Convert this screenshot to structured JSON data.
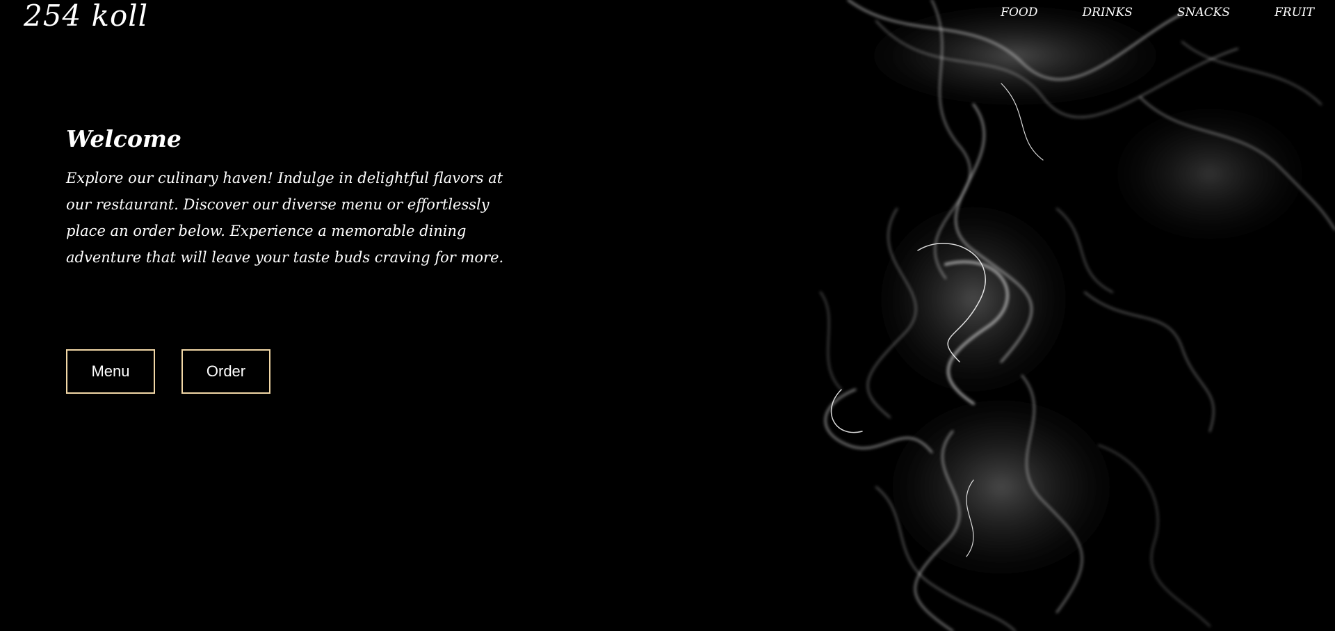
{
  "brand": {
    "logo_text": "254 koll"
  },
  "nav": {
    "items": [
      {
        "label": "FOOD"
      },
      {
        "label": "DRINKS"
      },
      {
        "label": "SNACKS"
      },
      {
        "label": "FRUIT"
      }
    ]
  },
  "hero": {
    "heading": "Welcome",
    "body": "Explore our culinary haven! Indulge in delightful flavors at our restaurant. Discover our diverse menu or effortlessly place an order below. Experience a memorable dining adventure that will leave your taste buds craving for more."
  },
  "actions": {
    "menu_label": "Menu",
    "order_label": "Order"
  },
  "colors": {
    "background": "#000000",
    "text": "#ffffff",
    "button_border": "#f1d7a6"
  }
}
